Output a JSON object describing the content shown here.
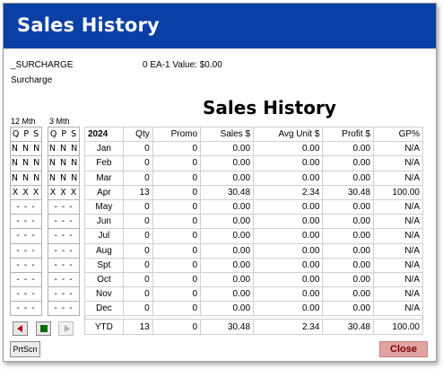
{
  "window": {
    "title": "Sales History"
  },
  "item": {
    "code": "_SURCHARGE",
    "value_line": "0 EA-1 Value: $0.00",
    "description": "Surcharge"
  },
  "heading": "Sales History",
  "qps": {
    "left_label": "12 Mth",
    "right_label": "3 Mth",
    "header": "Q P S",
    "left": [
      "N N N",
      "N N N",
      "N N N",
      "X X X",
      "- - -",
      "- - -",
      "- - -",
      "- - -",
      "- - -",
      "- - -",
      "- - -",
      "- - -"
    ],
    "right": [
      "N N N",
      "N N N",
      "N N N",
      "X X X",
      "- - -",
      "- - -",
      "- - -",
      "- - -",
      "- - -",
      "- - -",
      "- - -",
      "- - -"
    ]
  },
  "table": {
    "columns": [
      "2024",
      "Qty",
      "Promo",
      "Sales $",
      "Avg Unit $",
      "Profit $",
      "GP%"
    ],
    "rows": [
      [
        "Jan",
        "0",
        "0",
        "0.00",
        "0.00",
        "0.00",
        "N/A"
      ],
      [
        "Feb",
        "0",
        "0",
        "0.00",
        "0.00",
        "0.00",
        "N/A"
      ],
      [
        "Mar",
        "0",
        "0",
        "0.00",
        "0.00",
        "0.00",
        "N/A"
      ],
      [
        "Apr",
        "13",
        "0",
        "30.48",
        "2.34",
        "30.48",
        "100.00"
      ],
      [
        "May",
        "0",
        "0",
        "0.00",
        "0.00",
        "0.00",
        "N/A"
      ],
      [
        "Jun",
        "0",
        "0",
        "0.00",
        "0.00",
        "0.00",
        "N/A"
      ],
      [
        "Jul",
        "0",
        "0",
        "0.00",
        "0.00",
        "0.00",
        "N/A"
      ],
      [
        "Aug",
        "0",
        "0",
        "0.00",
        "0.00",
        "0.00",
        "N/A"
      ],
      [
        "Spt",
        "0",
        "0",
        "0.00",
        "0.00",
        "0.00",
        "N/A"
      ],
      [
        "Oct",
        "0",
        "0",
        "0.00",
        "0.00",
        "0.00",
        "N/A"
      ],
      [
        "Nov",
        "0",
        "0",
        "0.00",
        "0.00",
        "0.00",
        "N/A"
      ],
      [
        "Dec",
        "0",
        "0",
        "0.00",
        "0.00",
        "0.00",
        "N/A"
      ]
    ],
    "ytd": [
      "YTD",
      "13",
      "0",
      "30.48",
      "2.34",
      "30.48",
      "100.00"
    ]
  },
  "buttons": {
    "prev_icon": "triangle-left-icon",
    "stop_icon": "green-square-icon",
    "next_icon": "triangle-right-icon",
    "prtscn": "PrtScn",
    "close": "Close"
  },
  "colors": {
    "titlebar": "#0a3fa6",
    "close_bg": "#e2a3a3",
    "close_text": "#7a0000"
  }
}
